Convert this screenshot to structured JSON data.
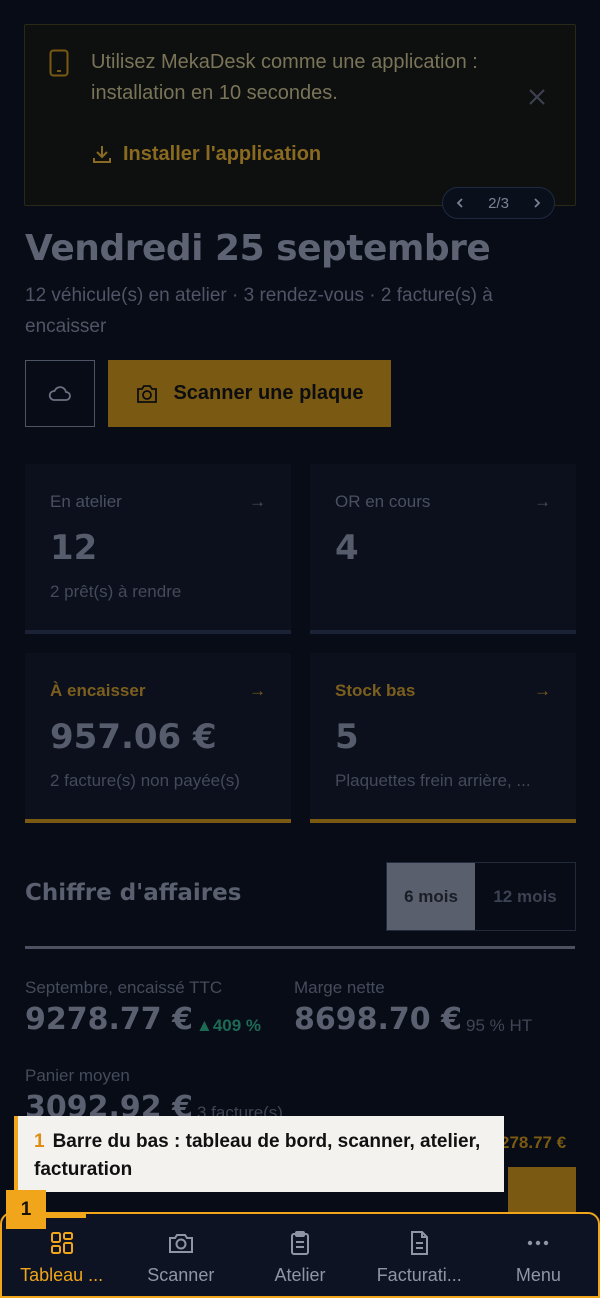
{
  "banner": {
    "message": "Utilisez MekaDesk comme une application : installation en 10 secondes.",
    "install_label": "Installer l'application",
    "pager": "2/3"
  },
  "header": {
    "date": "Vendredi 25 septembre",
    "summary": "12 véhicule(s) en atelier · 3 rendez-vous · 2 facture(s) à encaisser"
  },
  "actions": {
    "scan_label": "Scanner une plaque"
  },
  "cards": [
    {
      "label": "En atelier",
      "value": "12",
      "sub": "2 prêt(s) à rendre"
    },
    {
      "label": "OR en cours",
      "value": "4",
      "sub": ""
    },
    {
      "label": "À encaisser",
      "value": "957.06 €",
      "sub": "2 facture(s) non payée(s)"
    },
    {
      "label": "Stock bas",
      "value": "5",
      "sub": "Plaquettes frein arrière, ..."
    }
  ],
  "revenue": {
    "title": "Chiffre d'affaires",
    "periods": [
      "6 mois",
      "12 mois"
    ],
    "active_period": "6 mois",
    "month_label": "Septembre, encaissé TTC",
    "month_value": "9278.77 €",
    "growth": "▲409 %",
    "margin_label": "Marge nette",
    "margin_value": "8698.70 €",
    "margin_pct": "95 % HT",
    "basket_label": "Panier moyen",
    "basket_value": "3092.92 €",
    "basket_count": "3 facture(s)",
    "partial_value": "278.77 €"
  },
  "tooltip": {
    "number": "1",
    "text": "Barre du bas : tableau de bord, scanner, atelier, facturation"
  },
  "badge": "1",
  "nav": [
    {
      "label": "Tableau ...",
      "icon": "dashboard-icon",
      "active": true
    },
    {
      "label": "Scanner",
      "icon": "camera-icon"
    },
    {
      "label": "Atelier",
      "icon": "clipboard-icon"
    },
    {
      "label": "Facturati...",
      "icon": "document-icon"
    },
    {
      "label": "Menu",
      "icon": "more-icon"
    }
  ],
  "colors": {
    "accent": "#f0a51a",
    "background": "#080c16",
    "success": "#1d6a55"
  }
}
